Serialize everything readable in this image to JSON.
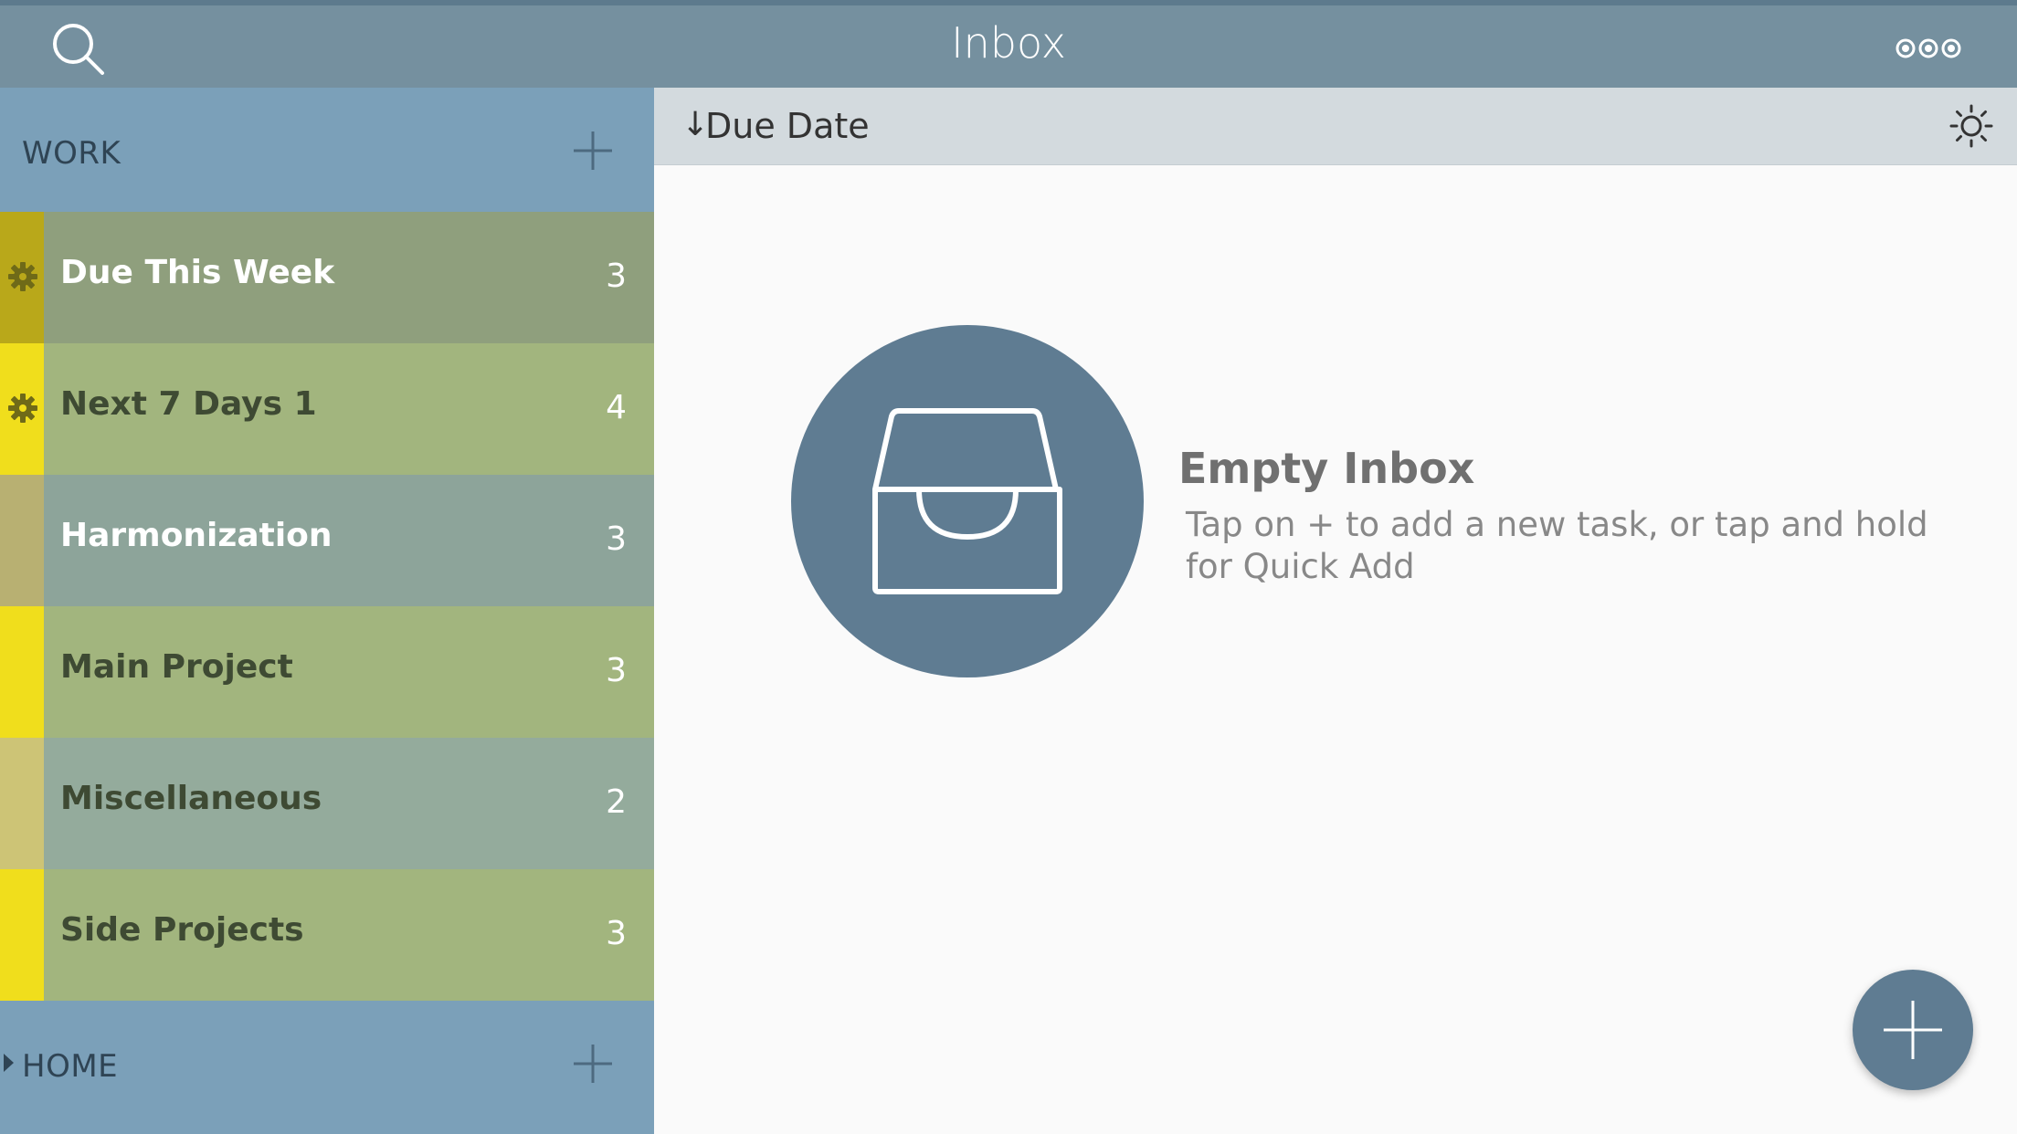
{
  "header": {
    "title": "Inbox",
    "search_icon": "search-icon",
    "more_icon": "more-options-icon"
  },
  "sidebar": {
    "work": {
      "label": "WORK",
      "add_icon": "plus-icon"
    },
    "home": {
      "label": "HOME",
      "add_icon": "plus-icon",
      "collapsed": true
    },
    "items": [
      {
        "name": "Due This Week",
        "count": "3",
        "stripe_color": "#b9a81a",
        "bg_color": "#8f9f7d",
        "name_color": "#ffffff",
        "smart": true
      },
      {
        "name": "Next 7 Days 1",
        "count": "4",
        "stripe_color": "#f0de1c",
        "bg_color": "#a2b57e",
        "name_color": "#3e4a33",
        "smart": true
      },
      {
        "name": "Harmonization",
        "count": "3",
        "stripe_color": "#b8b072",
        "bg_color": "#8da49a",
        "name_color": "#ffffff",
        "smart": false
      },
      {
        "name": "Main Project",
        "count": "3",
        "stripe_color": "#f0de1c",
        "bg_color": "#a2b57e",
        "name_color": "#3e4a33",
        "smart": false
      },
      {
        "name": "Miscellaneous",
        "count": "2",
        "stripe_color": "#cdc476",
        "bg_color": "#94ab9c",
        "name_color": "#3e4a33",
        "smart": false
      },
      {
        "name": "Side Projects",
        "count": "3",
        "stripe_color": "#f0de1c",
        "bg_color": "#a2b57e",
        "name_color": "#3e4a33",
        "smart": false
      }
    ]
  },
  "sortbar": {
    "arrow": "↓",
    "label": "Due Date",
    "theme_icon": "brightness-icon"
  },
  "empty_state": {
    "icon": "inbox-tray-icon",
    "title": "Empty Inbox",
    "description": "Tap on + to add a new task, or tap and hold for Quick Add"
  },
  "fab": {
    "icon": "plus-icon"
  },
  "colors": {
    "accent": "#5f7c92",
    "sidebar_bg": "#7ba0b9",
    "topbar_bg": "#75909f"
  }
}
